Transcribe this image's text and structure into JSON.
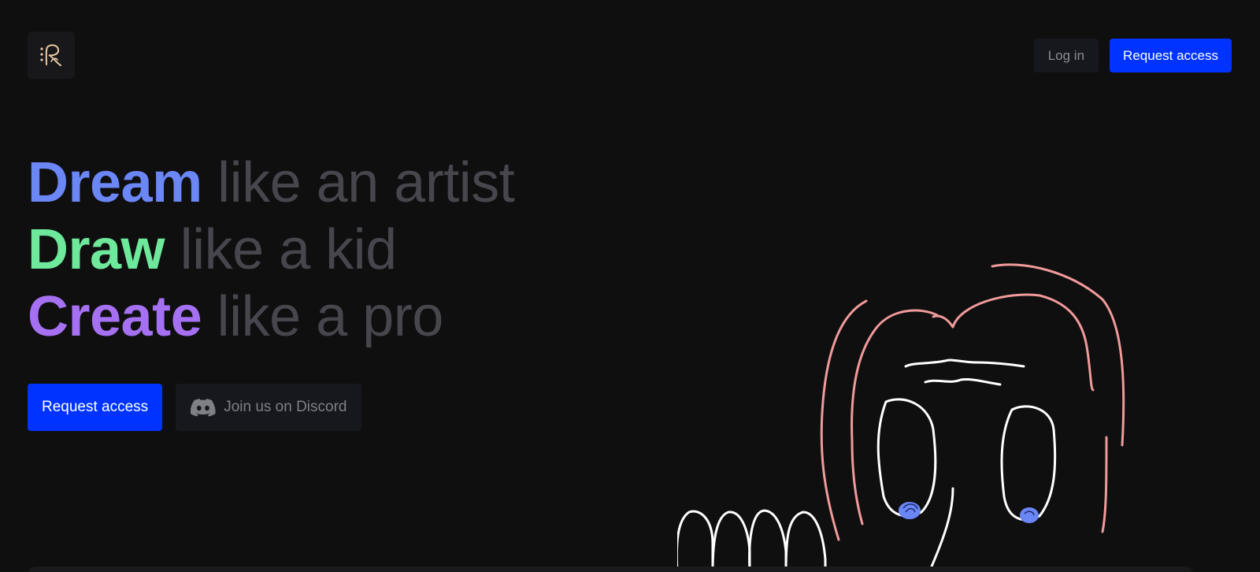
{
  "header": {
    "logo_icon": "rd-monogram-logo",
    "login_label": "Log in",
    "request_access_label": "Request access"
  },
  "hero": {
    "lines": [
      {
        "strong": "Dream",
        "rest": "like an artist",
        "color": "#6b86f5"
      },
      {
        "strong": "Draw",
        "rest": "like a kid",
        "color": "#6ee89a"
      },
      {
        "strong": "Create",
        "rest": "like a pro",
        "color": "#a571f2"
      }
    ],
    "request_access_label": "Request access",
    "discord_label": "Join us on Discord",
    "discord_icon": "discord-icon"
  },
  "colors": {
    "background": "#0f0f10",
    "primary": "#0033ff",
    "muted_text": "#46464c",
    "sketch_pink": "#f09a9a",
    "sketch_white": "#ffffff",
    "sketch_blue": "#6b86f5"
  }
}
